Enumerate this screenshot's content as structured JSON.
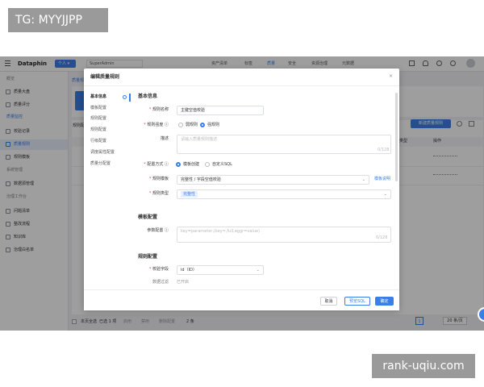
{
  "overlay_tags": {
    "top_left": "TG: MYYJJPP",
    "bottom_right": "rank-uqiu.com"
  },
  "app": {
    "logo": "Dataphin",
    "project_selector": "个人",
    "user_selector": "SuperAdmin",
    "top_nav": [
      "资产清单",
      "标签",
      "质量",
      "安全",
      "资源治理",
      "元数据"
    ],
    "sidebar": {
      "groups": [
        {
          "title": "概览",
          "items": [
            "质量大盘",
            "质量评分"
          ]
        },
        {
          "title": "质量监控",
          "items": [
            "校验记录",
            "质量规则",
            "规则模板"
          ]
        },
        {
          "title": "系统管理",
          "items": [
            "数据源管理"
          ]
        },
        {
          "title": "治理工作台",
          "items": [
            "问题清单",
            "整改流程",
            "知识库",
            "治理白名单"
          ]
        }
      ]
    },
    "page_tab": "质量规则",
    "table_tab": "规则配",
    "new_rule_button": "新建质量规则",
    "col_type": "类型",
    "col_action": "操作",
    "footer_select_page": "本页全选",
    "footer_selected": "已选 1 项",
    "footer_actions": [
      "启用",
      "禁用",
      "删除配置"
    ],
    "footer_total": "2 条",
    "pagination_page": "1",
    "page_size": "20 条/页",
    "accent_color": "#3a7ee8"
  },
  "modal": {
    "title": "编辑质量规则",
    "side_nav": [
      "基本信息",
      "模板配置",
      "规则配置",
      "规则配置",
      "行级配置",
      "调度属性配置",
      "质量分配置"
    ],
    "section_basic": "基本信息",
    "fields": {
      "rule_name_label": "规则名称",
      "rule_name_value": "主键空值校验",
      "rule_strength_label": "规则强度",
      "rule_strength_options": [
        "弱规则",
        "强规则"
      ],
      "description_label": "描述",
      "description_placeholder": "请输入质量规则描述",
      "description_counter": "0/128",
      "config_mode_label": "配置方式",
      "config_mode_options": [
        "模板创建",
        "自定义SQL"
      ],
      "rule_template_label": "规则模板",
      "rule_template_value": "完整性 / 字段空值校验",
      "rule_template_link": "模板说明",
      "rule_type_label": "规则类型",
      "rule_type_tag": "完整性"
    },
    "section_template": "模板配置",
    "params_label": "参数配置",
    "params_placeholder": "key=parameter,(key=,full,aggr=value)",
    "params_counter": "0/128",
    "section_rule": "规则配置",
    "check_field_label": "校验字段",
    "check_field_value": "id（ID）",
    "filter_label": "数据过滤",
    "filter_value": "已开启",
    "buttons": {
      "cancel": "取消",
      "preview_sql": "预览SQL",
      "ok": "确定"
    }
  }
}
